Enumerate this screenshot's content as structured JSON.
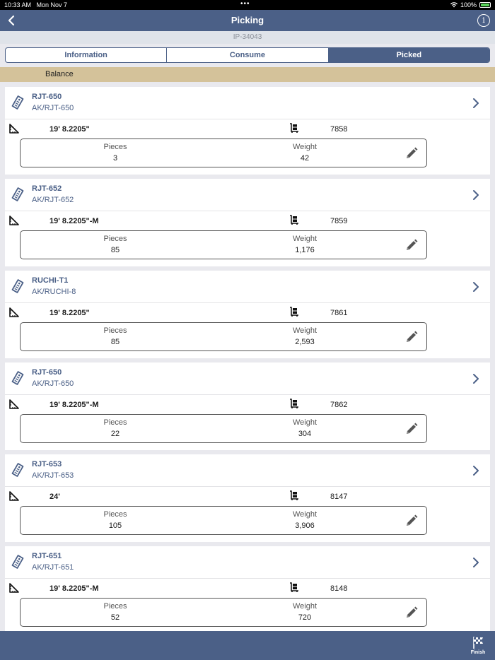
{
  "status_bar": {
    "time": "10:33 AM",
    "date": "Mon Nov 7",
    "battery": "100%"
  },
  "nav": {
    "title": "Picking",
    "back_icon": "chevron-left-icon",
    "info_icon": "info-icon",
    "info_glyph": "i"
  },
  "order_id": "IP-34043",
  "tabs": [
    {
      "label": "Information",
      "active": false
    },
    {
      "label": "Consume",
      "active": false
    },
    {
      "label": "Picked",
      "active": true
    }
  ],
  "balance_label": "Balance",
  "items": [
    {
      "code": "RJT-650",
      "sub": "AK/RJT-650",
      "length": "19' 8.2205\"",
      "number": "7858",
      "pieces_label": "Pieces",
      "pieces": "3",
      "weight_label": "Weight",
      "weight": "42"
    },
    {
      "code": "RJT-652",
      "sub": "AK/RJT-652",
      "length": "19' 8.2205\"-M",
      "number": "7859",
      "pieces_label": "Pieces",
      "pieces": "85",
      "weight_label": "Weight",
      "weight": "1,176"
    },
    {
      "code": "RUCHI-T1",
      "sub": "AK/RUCHI-8",
      "length": "19' 8.2205\"",
      "number": "7861",
      "pieces_label": "Pieces",
      "pieces": "85",
      "weight_label": "Weight",
      "weight": "2,593"
    },
    {
      "code": "RJT-650",
      "sub": "AK/RJT-650",
      "length": "19' 8.2205\"-M",
      "number": "7862",
      "pieces_label": "Pieces",
      "pieces": "22",
      "weight_label": "Weight",
      "weight": "304"
    },
    {
      "code": "RJT-653",
      "sub": "AK/RJT-653",
      "length": "24'",
      "number": "8147",
      "pieces_label": "Pieces",
      "pieces": "105",
      "weight_label": "Weight",
      "weight": "3,906"
    },
    {
      "code": "RJT-651",
      "sub": "AK/RJT-651",
      "length": "19' 8.2205\"-M",
      "number": "8148",
      "pieces_label": "Pieces",
      "pieces": "52",
      "weight_label": "Weight",
      "weight": "720"
    }
  ],
  "footer": {
    "finish_label": "Finish",
    "finish_icon": "checkered-flag-icon"
  },
  "colors": {
    "primary": "#4b6087",
    "balance_bg": "#d4c29a"
  }
}
